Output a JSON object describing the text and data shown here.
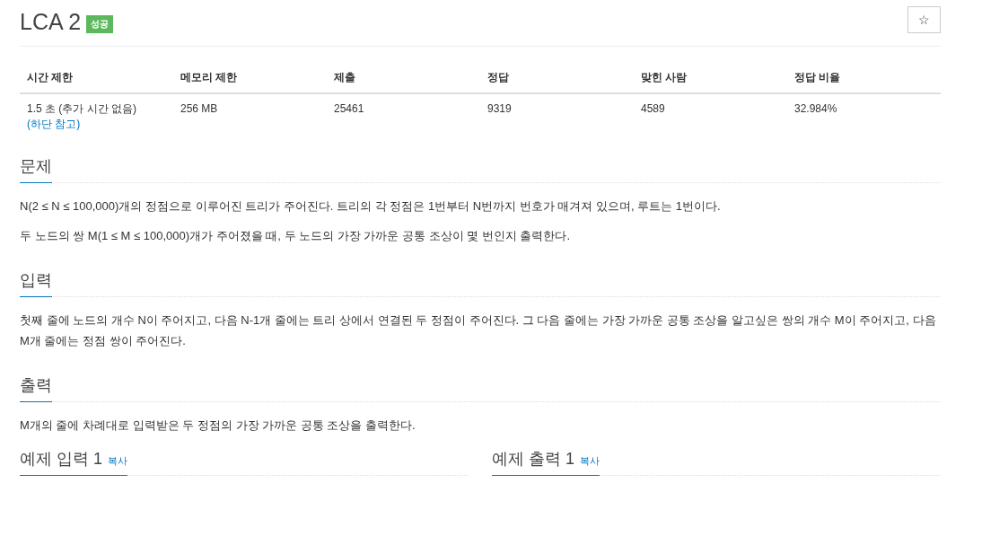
{
  "title": "LCA 2",
  "badge": "성공",
  "star": "☆",
  "table": {
    "columns": [
      "시간 제한",
      "메모리 제한",
      "제출",
      "정답",
      "맞힌 사람",
      "정답 비율"
    ],
    "row": [
      {
        "text": "1.5 초 (추가 시간 없음) ",
        "link": "(하단 참고)"
      },
      {
        "text": "256 MB"
      },
      {
        "text": "25461"
      },
      {
        "text": "9319"
      },
      {
        "text": "4589"
      },
      {
        "text": "32.984%"
      }
    ]
  },
  "sections": [
    {
      "heading": "문제",
      "paragraphs": [
        "N(2 ≤ N ≤ 100,000)개의 정점으로 이루어진 트리가 주어진다. 트리의 각 정점은 1번부터 N번까지 번호가 매겨져 있으며, 루트는 1번이다.",
        "두 노드의 쌍 M(1 ≤ M ≤ 100,000)개가 주어졌을 때, 두 노드의 가장 가까운 공통 조상이 몇 번인지 출력한다."
      ]
    },
    {
      "heading": "입력",
      "paragraphs": [
        "첫째 줄에 노드의 개수 N이 주어지고, 다음 N-1개 줄에는 트리 상에서 연결된 두 정점이 주어진다. 그 다음 줄에는 가장 가까운 공통 조상을 알고싶은 쌍의 개수 M이 주어지고, 다음 M개 줄에는 정점 쌍이 주어진다."
      ]
    },
    {
      "heading": "출력",
      "paragraphs": [
        "M개의 줄에 차례대로 입력받은 두 정점의 가장 가까운 공통 조상을 출력한다."
      ]
    }
  ],
  "examples": [
    {
      "heading": "예제 입력 1",
      "copy": "복사"
    },
    {
      "heading": "예제 출력 1",
      "copy": "복사"
    }
  ]
}
